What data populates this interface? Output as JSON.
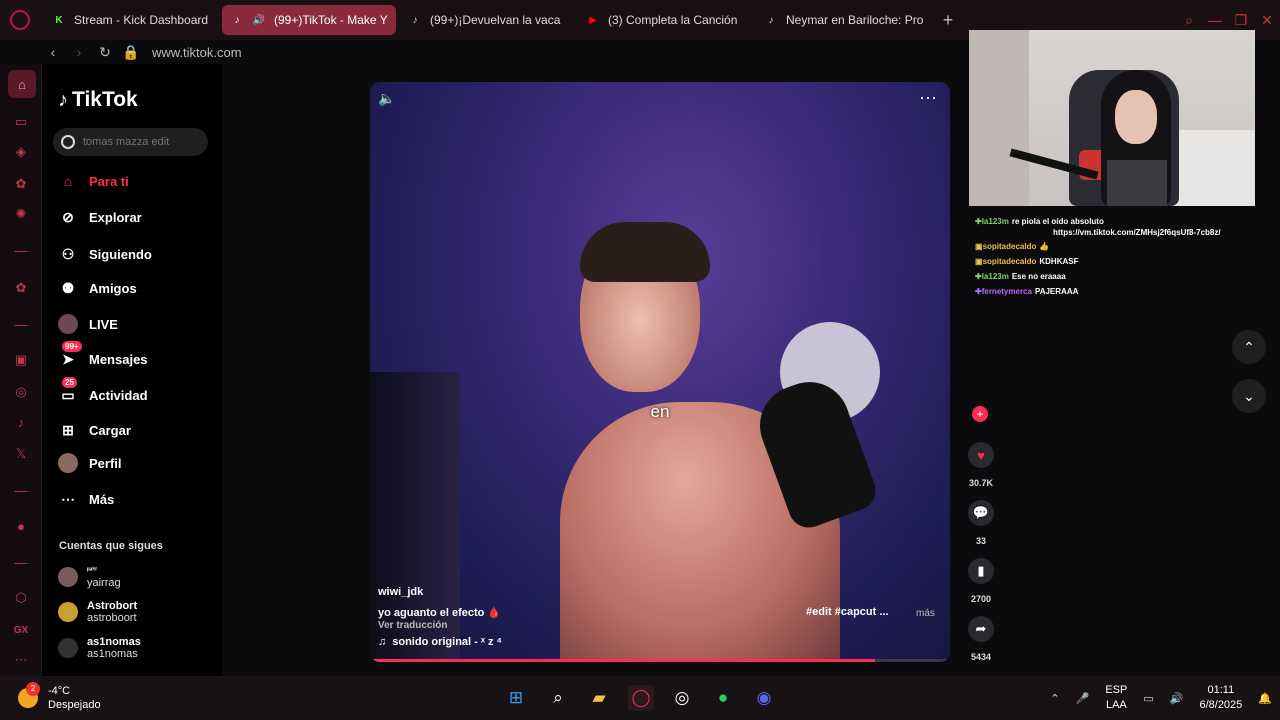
{
  "browser": {
    "tabs": [
      {
        "label": "Stream - Kick Dashboard",
        "icon": "kick-icon",
        "color": "#53fc18"
      },
      {
        "label": "(99+)TikTok - Make Y",
        "icon": "tiktok-icon",
        "active": true
      },
      {
        "label": "(99+)¡Devuelvan la vaca",
        "icon": "tiktok-icon"
      },
      {
        "label": "(3) Completa la Canción",
        "icon": "youtube-icon",
        "color": "#ff0000"
      },
      {
        "label": "Neymar en Bariloche: Pro",
        "icon": "tiktok-icon"
      }
    ],
    "new_tab": "+",
    "url": "www.tiktok.com"
  },
  "tiktok": {
    "logo_text": "TikTok",
    "search_placeholder": "tomas mazza edit",
    "nav": [
      {
        "label": "Para ti",
        "icon": "home-icon",
        "active": true
      },
      {
        "label": "Explorar",
        "icon": "compass-icon"
      },
      {
        "label": "Siguiendo",
        "icon": "following-icon"
      },
      {
        "label": "Amigos",
        "icon": "friends-icon"
      },
      {
        "label": "LIVE",
        "icon": "live-icon"
      },
      {
        "label": "Mensajes",
        "icon": "messages-icon",
        "badge": "99+"
      },
      {
        "label": "Actividad",
        "icon": "activity-icon",
        "badge": "25"
      },
      {
        "label": "Cargar",
        "icon": "upload-icon"
      },
      {
        "label": "Perfil",
        "icon": "profile-icon"
      },
      {
        "label": "Más",
        "icon": "more-icon"
      }
    ],
    "following_title": "Cuentas que sigues",
    "following": [
      {
        "name": "ᵖᵃⁱʳʳ",
        "handle": "yairrag"
      },
      {
        "name": "Astrobort",
        "handle": "astroboort"
      },
      {
        "name": "as1nomas",
        "handle": "as1nomas"
      }
    ]
  },
  "video": {
    "caption_word": "en",
    "author": "wiwi_jdk",
    "description": "yo aguanto el efecto 🩸",
    "translate": "Ver traducción",
    "sound": "sonido original - ˣ z ⁴",
    "tags": "#edit  #capcut  ...",
    "more": "más",
    "progress": 0.87,
    "likes": "30.7K",
    "comments": "33",
    "saves": "2700",
    "shares": "5434"
  },
  "chat": [
    {
      "user": "la123m",
      "user_color": "#7fd36a",
      "badge": "✚",
      "msg": "re piola el oído absoluto"
    },
    {
      "user": "sopitadecaldo",
      "user_color": "#e5c14a",
      "badge": "▣",
      "msg": "👍"
    },
    {
      "user": "sopitadecaldo",
      "user_color": "#e5c14a",
      "badge": "▣",
      "msg": "KDHKASF"
    },
    {
      "user": "la123m",
      "user_color": "#7fd36a",
      "badge": "✚",
      "msg": "Ese no eraaaa"
    },
    {
      "user": "fernetymerca",
      "user_color": "#b36bff",
      "badge": "✚",
      "msg": "PAJERAAA"
    }
  ],
  "chat_link": "https://vm.tiktok.com/ZMHsj2f6qsUf8-7cb8z/",
  "taskbar": {
    "weather_temp": "-4°C",
    "weather_desc": "Despejado",
    "weather_badge": "2",
    "lang1": "ESP",
    "lang2": "LAA",
    "time": "01:11",
    "date": "6/8/2025"
  }
}
